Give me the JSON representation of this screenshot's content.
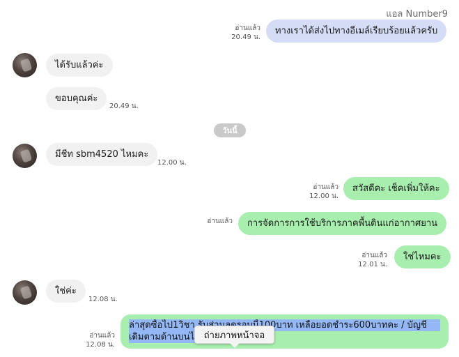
{
  "header": {
    "contact_name": "แอล Number9"
  },
  "day_divider": "วันนี้",
  "messages": [
    {
      "dir": "out",
      "text": "ทางเราได้ส่งไปทางอีเมล์เรียบร้อยแล้วครับ",
      "read": "อ่านแล้ว",
      "time": "20.49 น."
    },
    {
      "dir": "in",
      "text": "ได้รับแล้วค่ะ"
    },
    {
      "dir": "in",
      "text": "ขอบคุณค่ะ",
      "time": "20.49 น."
    },
    {
      "dir": "in",
      "text": "มีชีท sbm4520 ไหมคะ",
      "time": "12.00 น."
    },
    {
      "dir": "out",
      "text": "สวัสดีคะ เช็คเพิ่มให้คะ",
      "read": "อ่านแล้ว",
      "time": "12.00 น."
    },
    {
      "dir": "out",
      "text": "การจัดการการใช้บริการภาคพื้นดินแก่อากาศยาน",
      "read": "อ่านแล้ว"
    },
    {
      "dir": "out",
      "text": "ใช่ไหมคะ",
      "read": "อ่านแล้ว",
      "time": "12.01 น."
    },
    {
      "dir": "in",
      "text": "ใช่ค่ะ",
      "time": "12.08 น."
    },
    {
      "dir": "out",
      "text_line1": "ล่าสุดซื้อไป1วิชา รับส่วนลดรอบนี้100บาท เหลือยอดชำระ600บาทคะ / บัญชี",
      "text_line2": "เดิมตามด้านบนได้",
      "read": "อ่านแล้ว",
      "time": "12.08 น."
    }
  ],
  "tooltip": "ถ่ายภาพหน้าจอ",
  "colors": {
    "incoming_bubble": "#f1f1f1",
    "outgoing_blue": "#d5ddf6",
    "outgoing_green": "#a8eeaf",
    "selection": "#93b8f5"
  }
}
